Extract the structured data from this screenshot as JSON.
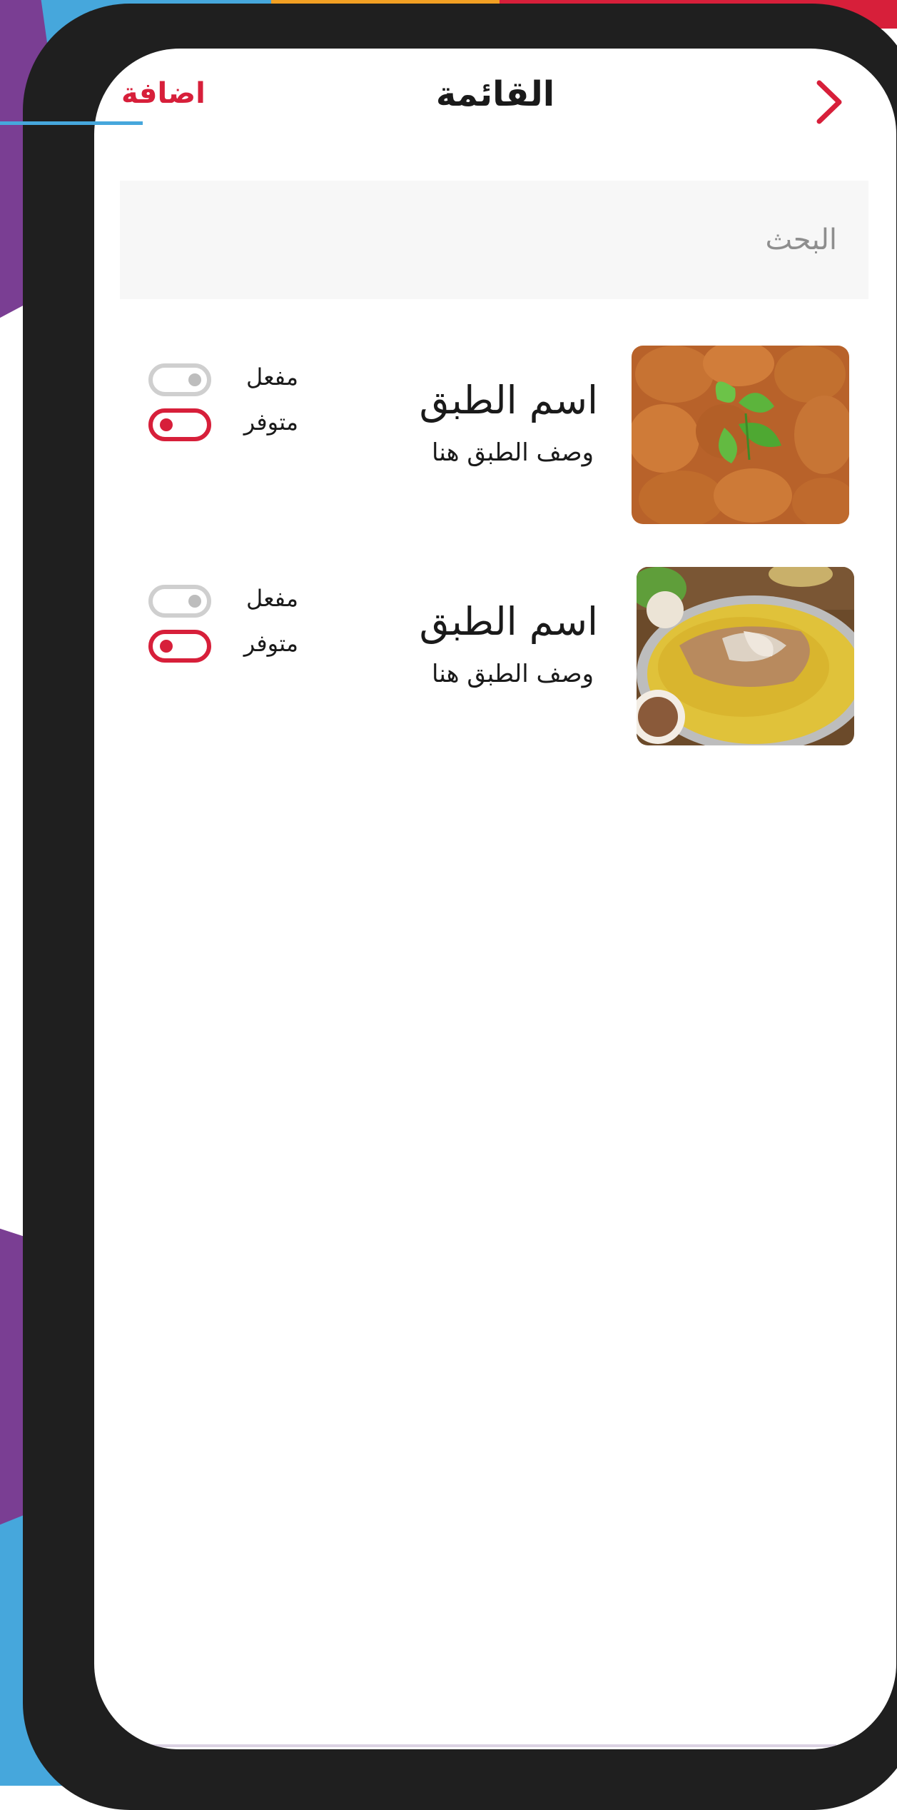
{
  "header": {
    "title": "القائمة",
    "add_label": "اضافة"
  },
  "search": {
    "placeholder": "البحث"
  },
  "items": [
    {
      "name": "اسم الطبق",
      "description": "وصف الطبق هنا",
      "enabled_label": "مفعل",
      "available_label": "متوفر",
      "enabled": false,
      "available": true
    },
    {
      "name": "اسم الطبق",
      "description": "وصف الطبق هنا",
      "enabled_label": "مفعل",
      "available_label": "متوفر",
      "enabled": false,
      "available": true
    }
  ],
  "colors": {
    "accent": "#d71f3a",
    "frame": "#1f1f1f",
    "toggle_off": "#cfcfcf",
    "search_bg": "#f7f7f7"
  },
  "icons": {
    "back": "chevron-right-icon"
  }
}
